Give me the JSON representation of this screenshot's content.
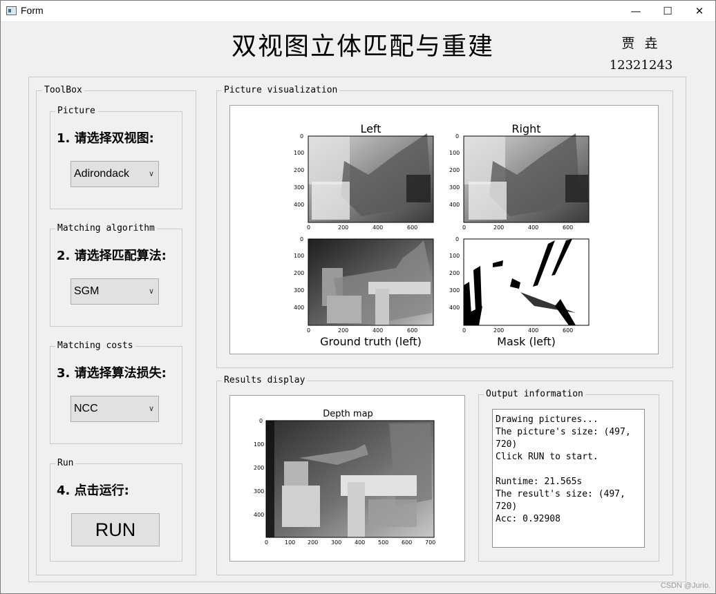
{
  "window": {
    "title": "Form",
    "minimize_icon": "—",
    "maximize_icon": "☐",
    "close_icon": "✕"
  },
  "header": {
    "title": "双视图立体匹配与重建",
    "author": "贾 垚",
    "student_id": "12321243"
  },
  "toolbox": {
    "label": "ToolBox",
    "picture": {
      "label": "Picture",
      "heading": "1. 请选择双视图:",
      "selected": "Adirondack"
    },
    "algorithm": {
      "label": "Matching algorithm",
      "heading": "2. 请选择匹配算法:",
      "selected": "SGM"
    },
    "costs": {
      "label": "Matching costs",
      "heading": "3. 请选择算法损失:",
      "selected": "NCC"
    },
    "run": {
      "label": "Run",
      "heading": "4. 点击运行:",
      "button": "RUN"
    }
  },
  "visualization": {
    "label": "Picture visualization",
    "plots": [
      {
        "title": "Left",
        "xlabel": ""
      },
      {
        "title": "Right",
        "xlabel": ""
      },
      {
        "title": "",
        "xlabel": "Ground truth (left)"
      },
      {
        "title": "",
        "xlabel": "Mask (left)"
      }
    ],
    "x_ticks": [
      "0",
      "200",
      "400",
      "600"
    ],
    "y_ticks": [
      "0",
      "100",
      "200",
      "300",
      "400"
    ]
  },
  "results": {
    "label": "Results display",
    "depth_title": "Depth map",
    "x_ticks": [
      "0",
      "100",
      "200",
      "300",
      "400",
      "500",
      "600",
      "700"
    ],
    "y_ticks": [
      "0",
      "100",
      "200",
      "300",
      "400"
    ]
  },
  "output": {
    "label": "Output information",
    "lines": [
      "Drawing pictures...",
      "The picture's size: (497,",
      "720)",
      "Click RUN to start.",
      "",
      "Runtime: 21.565s",
      "The result's size: (497,",
      "720)",
      "Acc: 0.92908"
    ]
  },
  "watermark": "CSDN @Jurio."
}
